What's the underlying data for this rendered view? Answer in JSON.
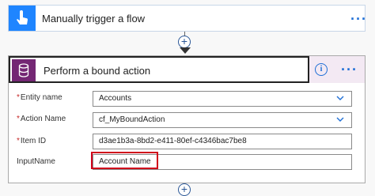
{
  "trigger": {
    "title": "Manually trigger a flow",
    "icon": "touch-hand-icon",
    "color": "#1f85ff",
    "more_label": "···"
  },
  "connector": {
    "add_label": "+"
  },
  "action": {
    "title": "Perform a bound action",
    "icon": "database-icon",
    "color": "#742774",
    "info_label": "i",
    "more_label": "···",
    "fields": [
      {
        "label": "Entity name",
        "required": "*",
        "value": "Accounts"
      },
      {
        "label": "Action Name",
        "required": "*",
        "value": "cf_MyBoundAction"
      },
      {
        "label": "Item ID",
        "required": "*",
        "value": "d3ae1b3a-8bd2-e411-80ef-c4346bac7be8"
      },
      {
        "label": "InputName",
        "required": "",
        "value": "Account Name"
      }
    ]
  },
  "bottom_connector": {
    "add_label": "+"
  }
}
